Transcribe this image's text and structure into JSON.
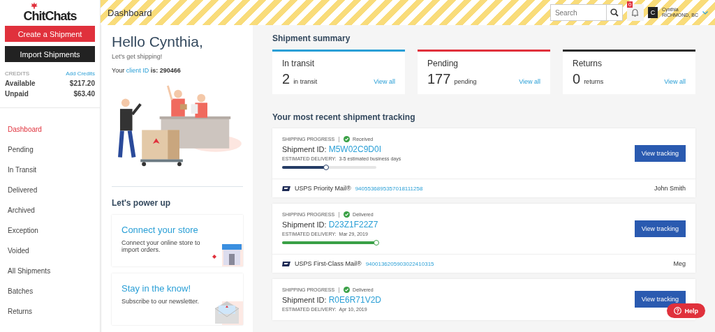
{
  "logo": {
    "text": "ChitChats"
  },
  "sidebar": {
    "buttons": [
      {
        "label": "Create a Shipment",
        "kind": "primary"
      },
      {
        "label": "Import Shipments",
        "kind": "dark"
      }
    ],
    "credits": {
      "heading": "CREDITS",
      "link": "Add Credits",
      "rows": [
        {
          "label": "Available",
          "value": "$217.20"
        },
        {
          "label": "Unpaid",
          "value": "$63.40"
        }
      ]
    },
    "items": [
      {
        "label": "Dashboard",
        "selected": true
      },
      {
        "label": "Pending",
        "selected": false
      },
      {
        "label": "In Transit",
        "selected": false
      },
      {
        "label": "Delivered",
        "selected": false
      },
      {
        "label": "Archived",
        "selected": false
      },
      {
        "label": "Exception",
        "selected": false
      },
      {
        "label": "Voided",
        "selected": false
      },
      {
        "label": "All Shipments",
        "selected": false
      },
      {
        "label": "Batches",
        "selected": false
      },
      {
        "label": "Returns",
        "selected": false
      }
    ]
  },
  "header": {
    "title": "Dashboard",
    "search": {
      "placeholder": "Search"
    },
    "notification_badge": "0",
    "user": {
      "initial": "C",
      "name": "Cynthia",
      "location": "RICHMOND, BC"
    }
  },
  "welcome": {
    "greeting": "Hello Cynthia,",
    "subtitle": "Let's get shipping!",
    "client_prefix": "Your",
    "client_link": "client ID",
    "client_suffix": "is: 290466"
  },
  "power_up": {
    "heading": "Let's power up",
    "cards": [
      {
        "title": "Connect your store",
        "text": "Connect your online store to import orders.",
        "kind": "store"
      },
      {
        "title": "Stay in the know!",
        "text": "Subscribe to our newsletter.",
        "kind": "newsletter"
      }
    ]
  },
  "summary": {
    "heading": "Shipment summary",
    "cards": [
      {
        "title": "In transit",
        "count": "2",
        "unit": "in transit",
        "link": "View all",
        "color": "#2a9fd6"
      },
      {
        "title": "Pending",
        "count": "177",
        "unit": "pending",
        "link": "View all",
        "color": "#e0313c"
      },
      {
        "title": "Returns",
        "count": "0",
        "unit": "returns",
        "link": "View all",
        "color": "#2b2b2b"
      }
    ]
  },
  "tracking": {
    "heading": "Your most recent shipment tracking",
    "items": [
      {
        "progress_label": "SHIPPING PROGRESS",
        "status": "Received",
        "id_label": "Shipment ID:",
        "id": "M5W02C9D0I",
        "delivery_label": "ESTIMATED DELIVERY:",
        "delivery": "3-5 estimated business days",
        "level": 0.47,
        "complete": false,
        "button": "View tracking",
        "carrier": "USPS Priority Mail®",
        "tracking_number": "9405536895357018111258",
        "recipient": "John Smith"
      },
      {
        "progress_label": "SHIPPING PROGRESS",
        "status": "Delivered",
        "id_label": "Shipment ID:",
        "id": "D23Z1F22Z7",
        "delivery_label": "ESTIMATED DELIVERY:",
        "delivery": "Mar 29, 2019",
        "level": 1,
        "complete": true,
        "button": "View tracking",
        "carrier": "USPS First-Class Mail®",
        "tracking_number": "9400136205903022410315",
        "recipient": "Meg"
      },
      {
        "progress_label": "SHIPPING PROGRESS",
        "status": "Delivered",
        "id_label": "Shipment ID:",
        "id": "R0E6R71V2D",
        "delivery_label": "ESTIMATED DELIVERY:",
        "delivery": "Apr 10, 2019",
        "button": "View tracking"
      }
    ]
  },
  "help": {
    "label": "Help"
  }
}
